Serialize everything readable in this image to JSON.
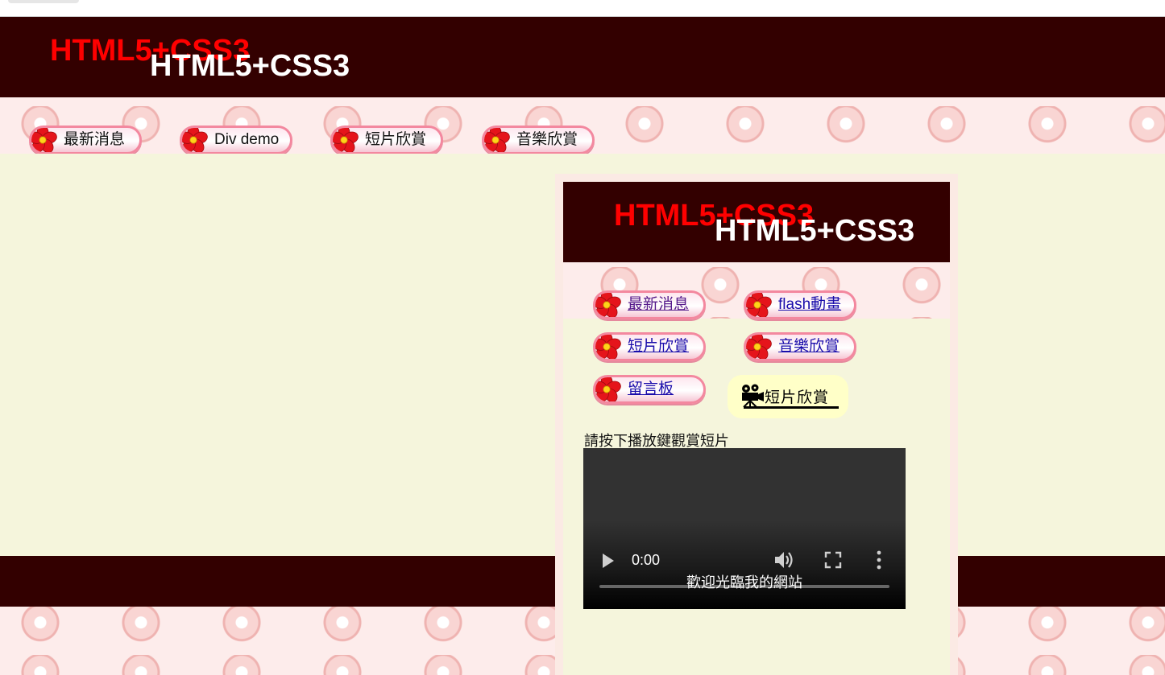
{
  "header": {
    "title_red": "HTML5+CSS3",
    "title_white": "HTML5+CSS3"
  },
  "nav": {
    "items": [
      {
        "label": "最新消息"
      },
      {
        "label": "Div demo"
      },
      {
        "label": "短片欣賞"
      },
      {
        "label": "音樂欣賞"
      }
    ]
  },
  "panel": {
    "header": {
      "title_red": "HTML5+CSS3",
      "title_white": "HTML5+CSS3"
    },
    "nav": {
      "items": [
        {
          "label": "最新消息"
        },
        {
          "label": "flash動畫"
        },
        {
          "label": "短片欣賞"
        },
        {
          "label": "音樂欣賞"
        },
        {
          "label": "留言板"
        }
      ]
    },
    "section_badge": "短片欣賞",
    "instruction": "請按下播放鍵觀賞短片",
    "video": {
      "time": "0:00",
      "caption": "歡迎光臨我的網站",
      "progress": 0
    }
  },
  "colors": {
    "header_bg": "#330000",
    "title_red": "#ff0000",
    "title_white": "#ffffff",
    "content_bg": "#f5f5dc",
    "pill_border": "#f3889f",
    "badge_bg": "#ffffc8",
    "link": "#1a0dab",
    "link_visited": "#551a8b"
  },
  "icons": {
    "nav": "flower-icon",
    "badge": "movie-camera-icon",
    "video_controls": [
      "play-icon",
      "volume-icon",
      "fullscreen-icon",
      "more-options-icon"
    ]
  }
}
